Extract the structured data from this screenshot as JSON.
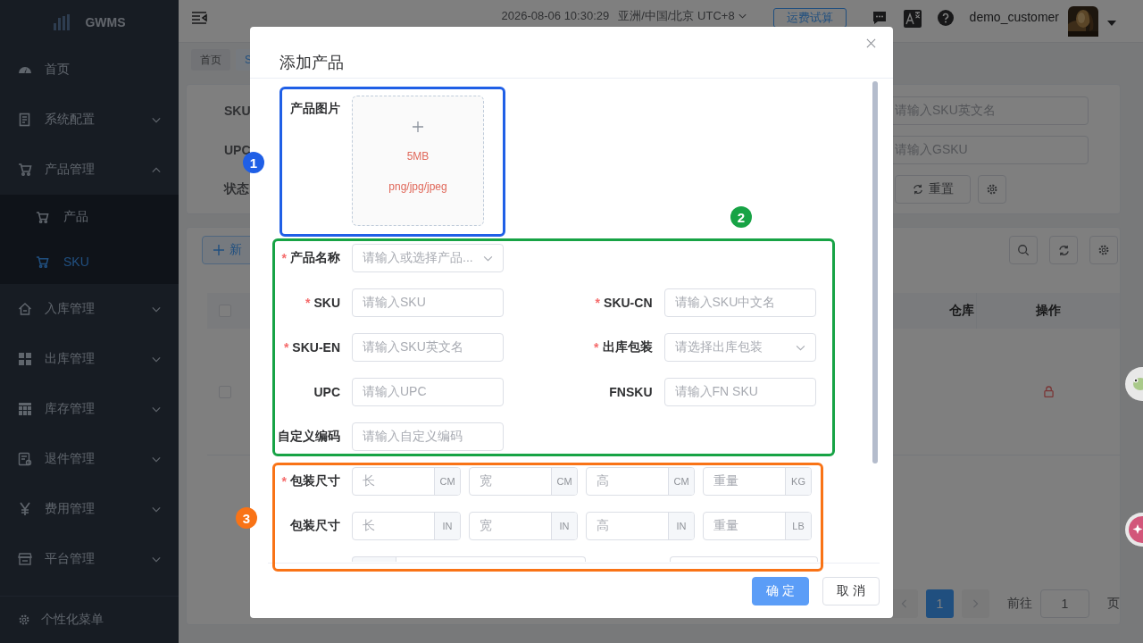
{
  "sidebar": {
    "logo": "GWMS",
    "items": [
      {
        "label": "首页",
        "kind": "link",
        "selected": false
      },
      {
        "label": "系统配置",
        "kind": "group",
        "expanded": false,
        "selected": false
      },
      {
        "label": "产品管理",
        "kind": "group",
        "expanded": true,
        "selected": false,
        "children": [
          {
            "label": "产品",
            "selected": false
          },
          {
            "label": "SKU",
            "selected": true
          }
        ]
      },
      {
        "label": "入库管理",
        "kind": "group",
        "expanded": false,
        "selected": false
      },
      {
        "label": "出库管理",
        "kind": "group",
        "expanded": false,
        "selected": false
      },
      {
        "label": "库存管理",
        "kind": "group",
        "expanded": false,
        "selected": false
      },
      {
        "label": "退件管理",
        "kind": "group",
        "expanded": false,
        "selected": false
      },
      {
        "label": "费用管理",
        "kind": "group",
        "expanded": false,
        "selected": false
      },
      {
        "label": "平台管理",
        "kind": "group",
        "expanded": false,
        "selected": false
      }
    ],
    "footer": "个性化菜单"
  },
  "topbar": {
    "datetime": "2026-08-06 10:30:29",
    "timezone": "亚洲/中国/北京 UTC+8",
    "freight_button": "运费试算",
    "user": "demo_customer"
  },
  "tags": [
    {
      "label": "首页",
      "selected": false
    },
    {
      "label": "S",
      "selected": true
    }
  ],
  "filter": {
    "labels": [
      "SKU",
      "UPC",
      "状态"
    ],
    "inputs": [
      {
        "placeholder": "请输入SKU英文名"
      },
      {
        "placeholder": "请输入GSKU"
      }
    ],
    "reset_button": "重置"
  },
  "table": {
    "add_button": "新",
    "columns": [
      "仓库",
      "操作"
    ],
    "header_checked": false,
    "rows": [
      {
        "checked": false,
        "locked": true
      }
    ]
  },
  "pagination": {
    "pages": [
      {
        "label": "1",
        "selected": true
      }
    ],
    "goto_label": "前往",
    "goto_value": "1",
    "suffix": "页"
  },
  "dialog": {
    "title": "添加产品",
    "image_field": {
      "label": "产品图片",
      "size_hint": "5MB",
      "format_hint": "png/jpg/jpeg"
    },
    "field_rows": [
      {
        "fields": [
          {
            "label": "产品名称",
            "required_mark": "*",
            "kind": "select",
            "placeholder": "请输入或选择产品..."
          }
        ]
      },
      {
        "fields": [
          {
            "label": "SKU",
            "required_mark": "*",
            "kind": "input",
            "placeholder": "请输入SKU"
          },
          {
            "label": "SKU-CN",
            "required_mark": "*",
            "kind": "input",
            "placeholder": "请输入SKU中文名"
          }
        ]
      },
      {
        "fields": [
          {
            "label": "SKU-EN",
            "required_mark": "*",
            "kind": "input",
            "placeholder": "请输入SKU英文名"
          },
          {
            "label": "出库包装",
            "required_mark": "*",
            "kind": "select",
            "placeholder": "请选择出库包装"
          }
        ]
      },
      {
        "fields": [
          {
            "label": "UPC",
            "kind": "input",
            "placeholder": "请输入UPC"
          },
          {
            "label": "FNSKU",
            "kind": "input",
            "placeholder": "请输入FN SKU"
          }
        ]
      },
      {
        "fields": [
          {
            "label": "自定义编码",
            "kind": "input",
            "placeholder": "请输入自定义编码"
          }
        ]
      }
    ],
    "dimension_rows": [
      {
        "label": "包装尺寸",
        "required_mark": "*",
        "inputs": [
          {
            "placeholder": "长",
            "unit": "CM"
          },
          {
            "placeholder": "宽",
            "unit": "CM"
          },
          {
            "placeholder": "高",
            "unit": "CM"
          },
          {
            "placeholder": "重量",
            "unit": "KG"
          }
        ]
      },
      {
        "label": "包装尺寸",
        "inputs": [
          {
            "placeholder": "长",
            "unit": "IN"
          },
          {
            "placeholder": "宽",
            "unit": "IN"
          },
          {
            "placeholder": "高",
            "unit": "IN"
          },
          {
            "placeholder": "重量",
            "unit": "LB"
          }
        ]
      }
    ],
    "buttons": [
      {
        "label": "确 定",
        "kind": "primary"
      },
      {
        "label": "取 消",
        "kind": "default"
      }
    ]
  },
  "annotations": [
    {
      "number": "1",
      "color": "#1f5fe6"
    },
    {
      "number": "2",
      "color": "#17a345"
    },
    {
      "number": "3",
      "color": "#f97316"
    }
  ]
}
